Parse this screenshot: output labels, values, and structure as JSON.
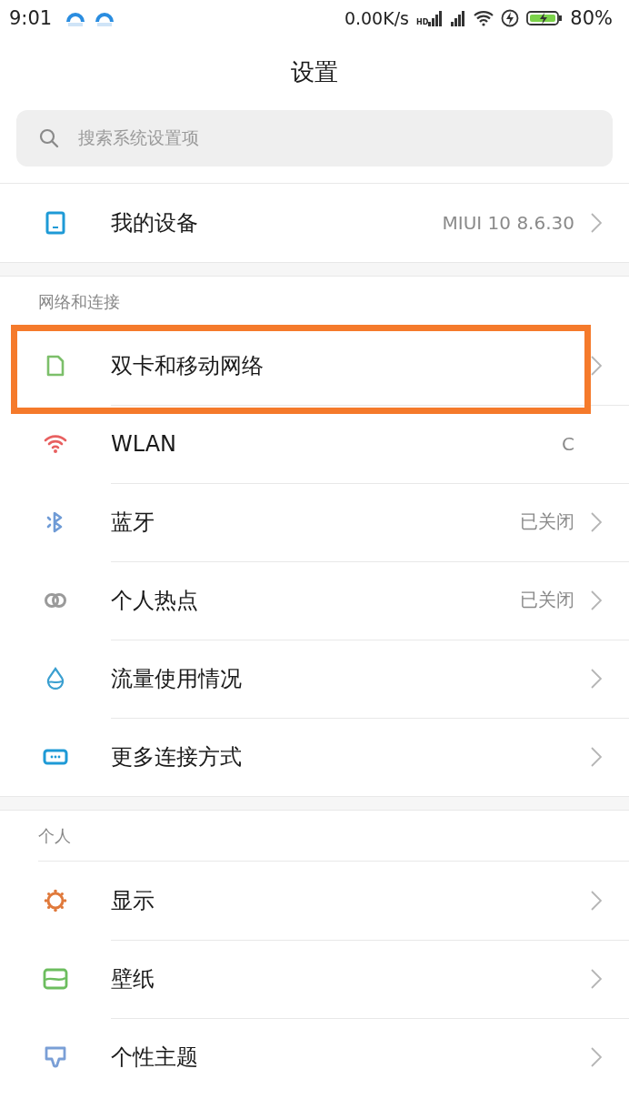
{
  "status_bar": {
    "time": "9:01",
    "speed": "0.00K/s",
    "hd": "HD",
    "battery": "80%"
  },
  "title": "设置",
  "search": {
    "placeholder": "搜索系统设置项"
  },
  "sections": [
    {
      "items": [
        {
          "label": "我的设备",
          "value": "MIUI 10 8.6.30",
          "chevron": true,
          "highlighted": false
        }
      ]
    },
    {
      "header": "网络和连接",
      "items": [
        {
          "label": "双卡和移动网络",
          "chevron": true,
          "highlighted": true
        },
        {
          "label": "WLAN",
          "value": "C",
          "chevron": false,
          "highlighted": false
        },
        {
          "label": "蓝牙",
          "value": "已关闭",
          "chevron": true,
          "highlighted": false
        },
        {
          "label": "个人热点",
          "value": "已关闭",
          "chevron": true,
          "highlighted": false
        },
        {
          "label": "流量使用情况",
          "chevron": true,
          "highlighted": false
        },
        {
          "label": "更多连接方式",
          "chevron": true,
          "highlighted": false
        }
      ]
    },
    {
      "header": "个人",
      "items": [
        {
          "label": "显示",
          "chevron": true,
          "highlighted": false
        },
        {
          "label": "壁纸",
          "chevron": true,
          "highlighted": false
        },
        {
          "label": "个性主题",
          "chevron": true,
          "highlighted": false
        }
      ]
    }
  ]
}
